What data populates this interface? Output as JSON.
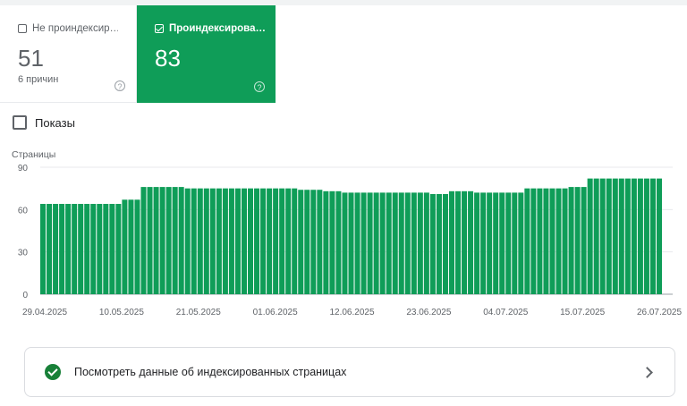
{
  "cards": {
    "not_indexed": {
      "label": "Не проиндексир…",
      "count": "51",
      "sub": "6 причин",
      "help": "?"
    },
    "indexed": {
      "label": "Проиндексирова…",
      "count": "83",
      "help": "?"
    }
  },
  "toggle": {
    "label": "Показы",
    "checked": false
  },
  "chart_data": {
    "type": "bar",
    "ylabel": "Страницы",
    "ylim": [
      0,
      90
    ],
    "yticks": [
      "0",
      "30",
      "60",
      "90"
    ],
    "xticks": [
      "29.04.2025",
      "10.05.2025",
      "21.05.2025",
      "01.06.2025",
      "12.06.2025",
      "23.06.2025",
      "04.07.2025",
      "15.07.2025",
      "26.07.2025"
    ],
    "color": "#0f9d58",
    "values": [
      64,
      64,
      64,
      64,
      64,
      64,
      64,
      64,
      64,
      64,
      64,
      64,
      64,
      67,
      67,
      67,
      76,
      76,
      76,
      76,
      76,
      76,
      76,
      75,
      75,
      75,
      75,
      75,
      75,
      75,
      75,
      75,
      75,
      75,
      75,
      75,
      75,
      75,
      75,
      75,
      75,
      74,
      74,
      74,
      74,
      73,
      73,
      73,
      72,
      72,
      72,
      72,
      72,
      72,
      72,
      72,
      72,
      72,
      72,
      72,
      72,
      72,
      71,
      71,
      71,
      73,
      73,
      73,
      73,
      72,
      72,
      72,
      72,
      72,
      72,
      72,
      72,
      75,
      75,
      75,
      75,
      75,
      75,
      75,
      76,
      76,
      76,
      82,
      82,
      82,
      82,
      82,
      82,
      82,
      82,
      82,
      82,
      82,
      82
    ]
  },
  "link": {
    "text": "Посмотреть данные об индексированных страницах"
  }
}
